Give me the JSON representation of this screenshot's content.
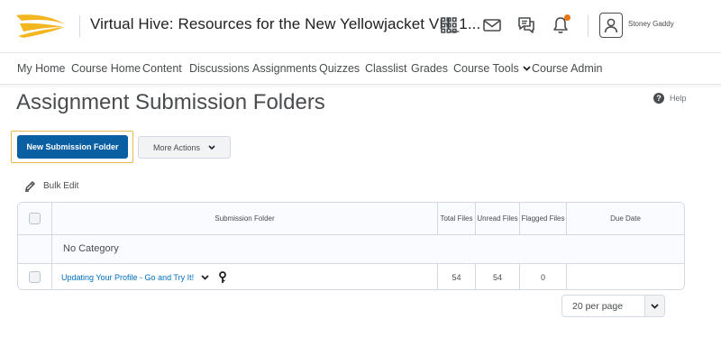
{
  "header": {
    "course_title": "Virtual Hive: Resources for the New Yellowjacket VH_1...",
    "user_name": "Stoney Gaddy",
    "icons": [
      "app-grid-icon",
      "envelope-icon",
      "chat-bubbles-icon",
      "bell-icon",
      "user-avatar-icon"
    ],
    "notification_dot_color": "#e87511",
    "brand_colors": [
      "#f3b61f",
      "#0a5fa3"
    ]
  },
  "nav": {
    "items": [
      {
        "label": "My Home"
      },
      {
        "label": "Course Home"
      },
      {
        "label": "Content"
      },
      {
        "label": "Discussions"
      },
      {
        "label": "Assignments"
      },
      {
        "label": "Quizzes"
      },
      {
        "label": "Classlist"
      },
      {
        "label": "Grades"
      },
      {
        "label": "Course Tools"
      },
      {
        "label": "Course Admin"
      }
    ]
  },
  "page": {
    "title": "Assignment Submission Folders",
    "help_label": "Help"
  },
  "toolbar": {
    "new_folder_label": "New Submission Folder",
    "more_actions_label": "More Actions",
    "bulk_edit_label": "Bulk Edit",
    "primary_color": "#0a5fa3"
  },
  "table": {
    "headers": {
      "folder": "Submission Folder",
      "total_files": "Total Files",
      "unread_files": "Unread Files",
      "flagged_files": "Flagged Files",
      "due_date": "Due Date"
    },
    "category": "No Category",
    "rows": [
      {
        "folder": "Updating Your Profile - Go and Try It!",
        "total_files": "54",
        "unread_files": "54",
        "flagged_files": "0",
        "due_date": ""
      }
    ]
  },
  "pager": {
    "per_page_label": "20 per page"
  }
}
